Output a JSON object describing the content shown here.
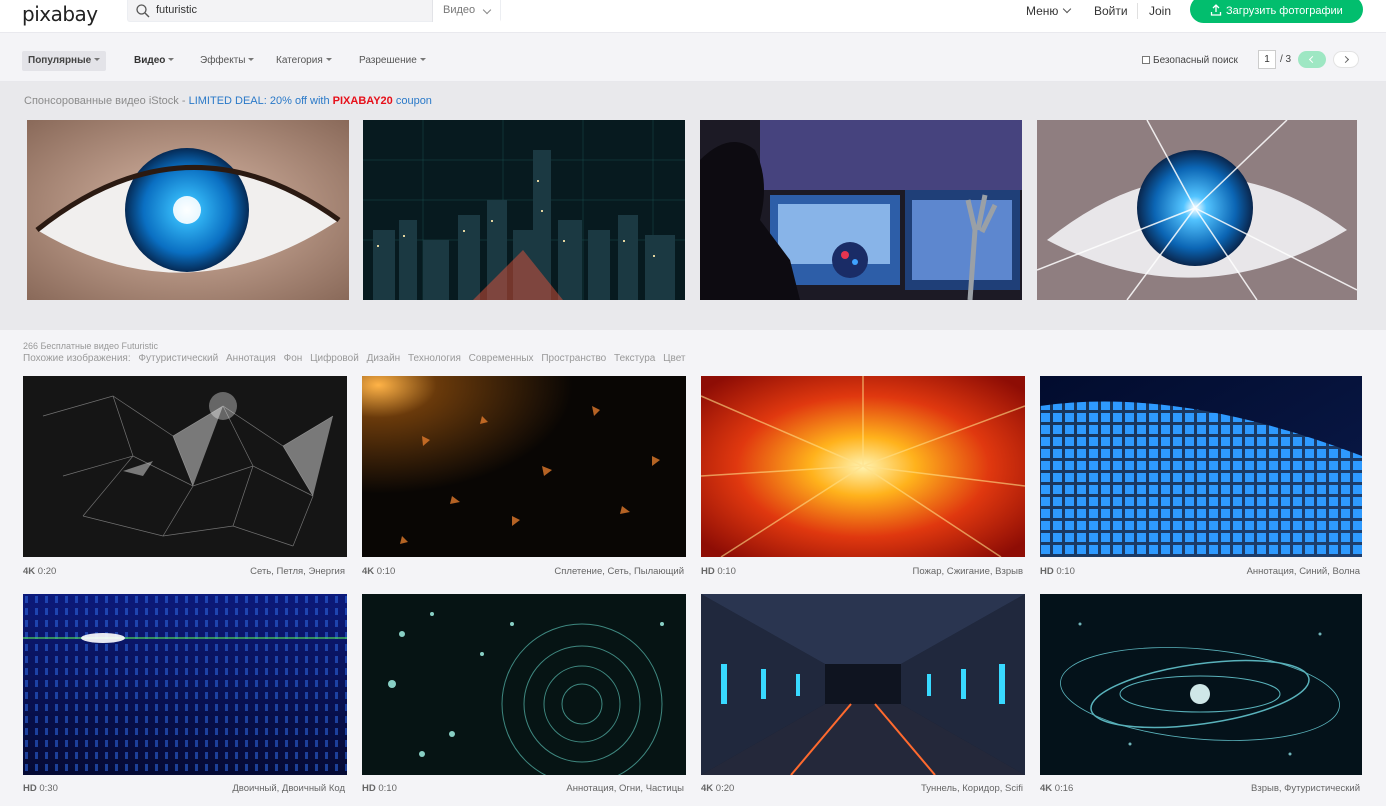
{
  "header": {
    "logo": "pixabay",
    "search": {
      "value": "futuristic",
      "type_label": "Видео"
    },
    "menu_label": "Меню",
    "login_label": "Войти",
    "join_label": "Join",
    "upload_label": "Загрузить фотографии",
    "accent_color": "#02be6e"
  },
  "filters": {
    "items": [
      {
        "label": "Популярные"
      },
      {
        "label": "Видео"
      },
      {
        "label": "Эффекты"
      },
      {
        "label": "Категория"
      },
      {
        "label": "Разрешение"
      }
    ],
    "safe_search_label": "Безопасный поиск",
    "page_value": "1",
    "page_total": "/ 3"
  },
  "sponsored": {
    "prefix": "Спонсорованные видео iStock - ",
    "deal": "LIMITED DEAL: 20% off with ",
    "code": "PIXABAY20",
    "suffix": " coupon",
    "images": [
      {
        "icon": "blue-eye-closeup"
      },
      {
        "icon": "city-night-digital-grid"
      },
      {
        "icon": "woman-hologram-robot-hand"
      },
      {
        "icon": "eye-laser-beams"
      }
    ]
  },
  "results": {
    "count_text": "266 Бесплатные видео Futuristic",
    "related_label": "Похожие изображения:",
    "related": [
      "Футуристический",
      "Аннотация",
      "Фон",
      "Цифровой",
      "Дизайн",
      "Технология",
      "Современных",
      "Пространство",
      "Текстура",
      "Цвет"
    ],
    "videos": [
      {
        "quality": "4K",
        "duration": "0:20",
        "tags": "Сеть, Петля, Энергия"
      },
      {
        "quality": "4K",
        "duration": "0:10",
        "tags": "Сплетение, Сеть, Пылающий"
      },
      {
        "quality": "HD",
        "duration": "0:10",
        "tags": "Пожар, Сжигание, Взрыв"
      },
      {
        "quality": "HD",
        "duration": "0:10",
        "tags": "Аннотация, Синий, Волна"
      },
      {
        "quality": "HD",
        "duration": "0:30",
        "tags": "Двоичный, Двоичный Код"
      },
      {
        "quality": "HD",
        "duration": "0:10",
        "tags": "Аннотация, Огни, Частицы"
      },
      {
        "quality": "4K",
        "duration": "0:20",
        "tags": "Туннель, Коридор, Scifi"
      },
      {
        "quality": "4K",
        "duration": "0:16",
        "tags": "Взрыв, Футуристический"
      }
    ]
  }
}
